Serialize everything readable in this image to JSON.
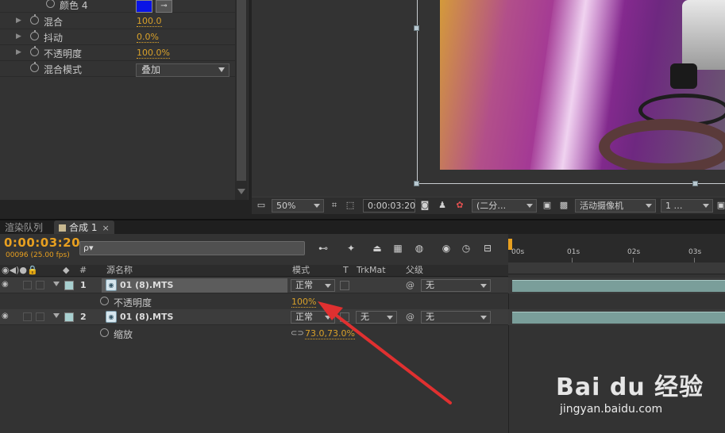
{
  "effects": {
    "rows": [
      {
        "label": "颜色 4",
        "value": ""
      },
      {
        "label": "混合",
        "value": "100.0"
      },
      {
        "label": "抖动",
        "value": "0.0%"
      },
      {
        "label": "不透明度",
        "value": "100.0%"
      },
      {
        "label": "混合模式",
        "value": "叠加"
      }
    ],
    "color_swatch": "#0a14e6"
  },
  "viewer": {
    "zoom": "50%",
    "timecode": "0:00:03:20",
    "resolution": "(二分…",
    "camera": "活动摄像机",
    "views": "1 …"
  },
  "tabs": {
    "render_queue": "渲染队列",
    "comp": "合成 1",
    "close": "×"
  },
  "timeline": {
    "timecode": "0:00:03:20",
    "frames": "00096 (25.00 fps)",
    "search_placeholder": "ρ▾",
    "ruler": [
      "00s",
      "01s",
      "02s",
      "03s"
    ],
    "headers": {
      "num": "#",
      "source": "源名称",
      "mode": "模式",
      "t": "T",
      "trkmat": "TrkMat",
      "parent": "父级"
    },
    "layers": [
      {
        "num": "1",
        "name": "01 (8).MTS",
        "mode": "正常",
        "parent": "无",
        "prop_label": "不透明度",
        "prop_value": "100%"
      },
      {
        "num": "2",
        "name": "01 (8).MTS",
        "mode": "正常",
        "trkmat": "无",
        "parent": "无",
        "prop_label": "缩放",
        "prop_value": "73.0,73.0%"
      }
    ]
  },
  "watermark": {
    "logo": "Bai du 经验",
    "url": "jingyan.baidu.com"
  }
}
